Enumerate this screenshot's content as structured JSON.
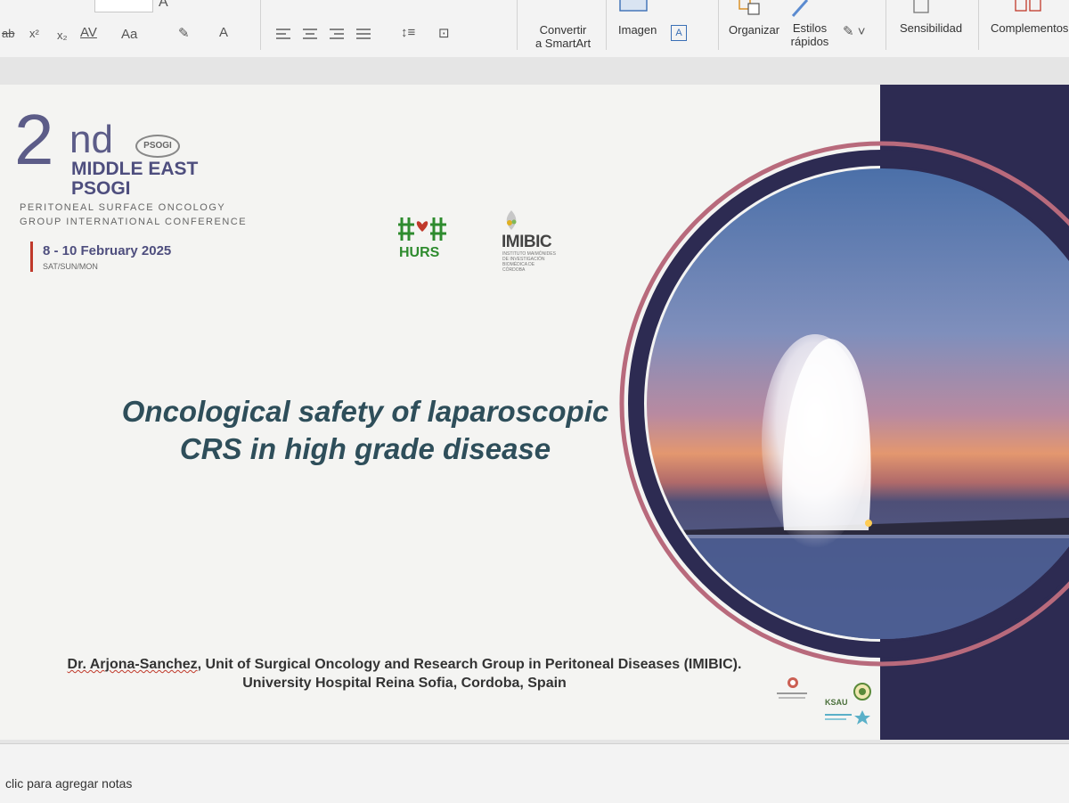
{
  "ribbon": {
    "convert_line1": "Convertir",
    "convert_line2": "a SmartArt",
    "image_label": "Imagen",
    "organize_label": "Organizar",
    "quick_styles_line1": "Estilos",
    "quick_styles_line2": "rápidos",
    "sensitivity_label": "Sensibilidad",
    "addins_label": "Complementos",
    "superscript": "x²",
    "subscript": "x₂",
    "char_spacing": "AV",
    "change_case": "Aa",
    "font_color_a": "A",
    "strikethrough": "ab"
  },
  "slide": {
    "logo_number": "2",
    "logo_ordinal": "nd",
    "logo_line1": "MIDDLE EAST",
    "logo_line2": "PSOGI",
    "logo_badge": "PSOGI",
    "conference_line1": "PERITONEAL SURFACE ONCOLOGY",
    "conference_line2": "GROUP INTERNATIONAL CONFERENCE",
    "dates": "8 - 10 February 2025",
    "days": "SAT/SUN/MON",
    "hurs_logo": "HURS",
    "imibic_logo": "IMIBIC",
    "imibic_sub": "INSTITUTO MAIMÓNIDES DE INVESTIGACIÓN BIOMÉDICA DE CÓRDOBA",
    "title_line1": "Oncological safety of laparoscopic",
    "title_line2": "CRS in high grade disease",
    "author_name": "Dr. Arjona-Sanchez",
    "author_rest": ", Unit of Surgical Oncology and Research Group in Peritoneal Diseases (IMIBIC).",
    "author_line2": "University Hospital Reina Sofia, Cordoba, Spain",
    "ksau_logo": "KSAU"
  },
  "notes": {
    "placeholder": "clic para agregar notas"
  },
  "colors": {
    "title": "#2e4e5a",
    "navy_panel": "#2d2b52",
    "ring": "#b86a7c",
    "accent_red": "#c0392b"
  }
}
